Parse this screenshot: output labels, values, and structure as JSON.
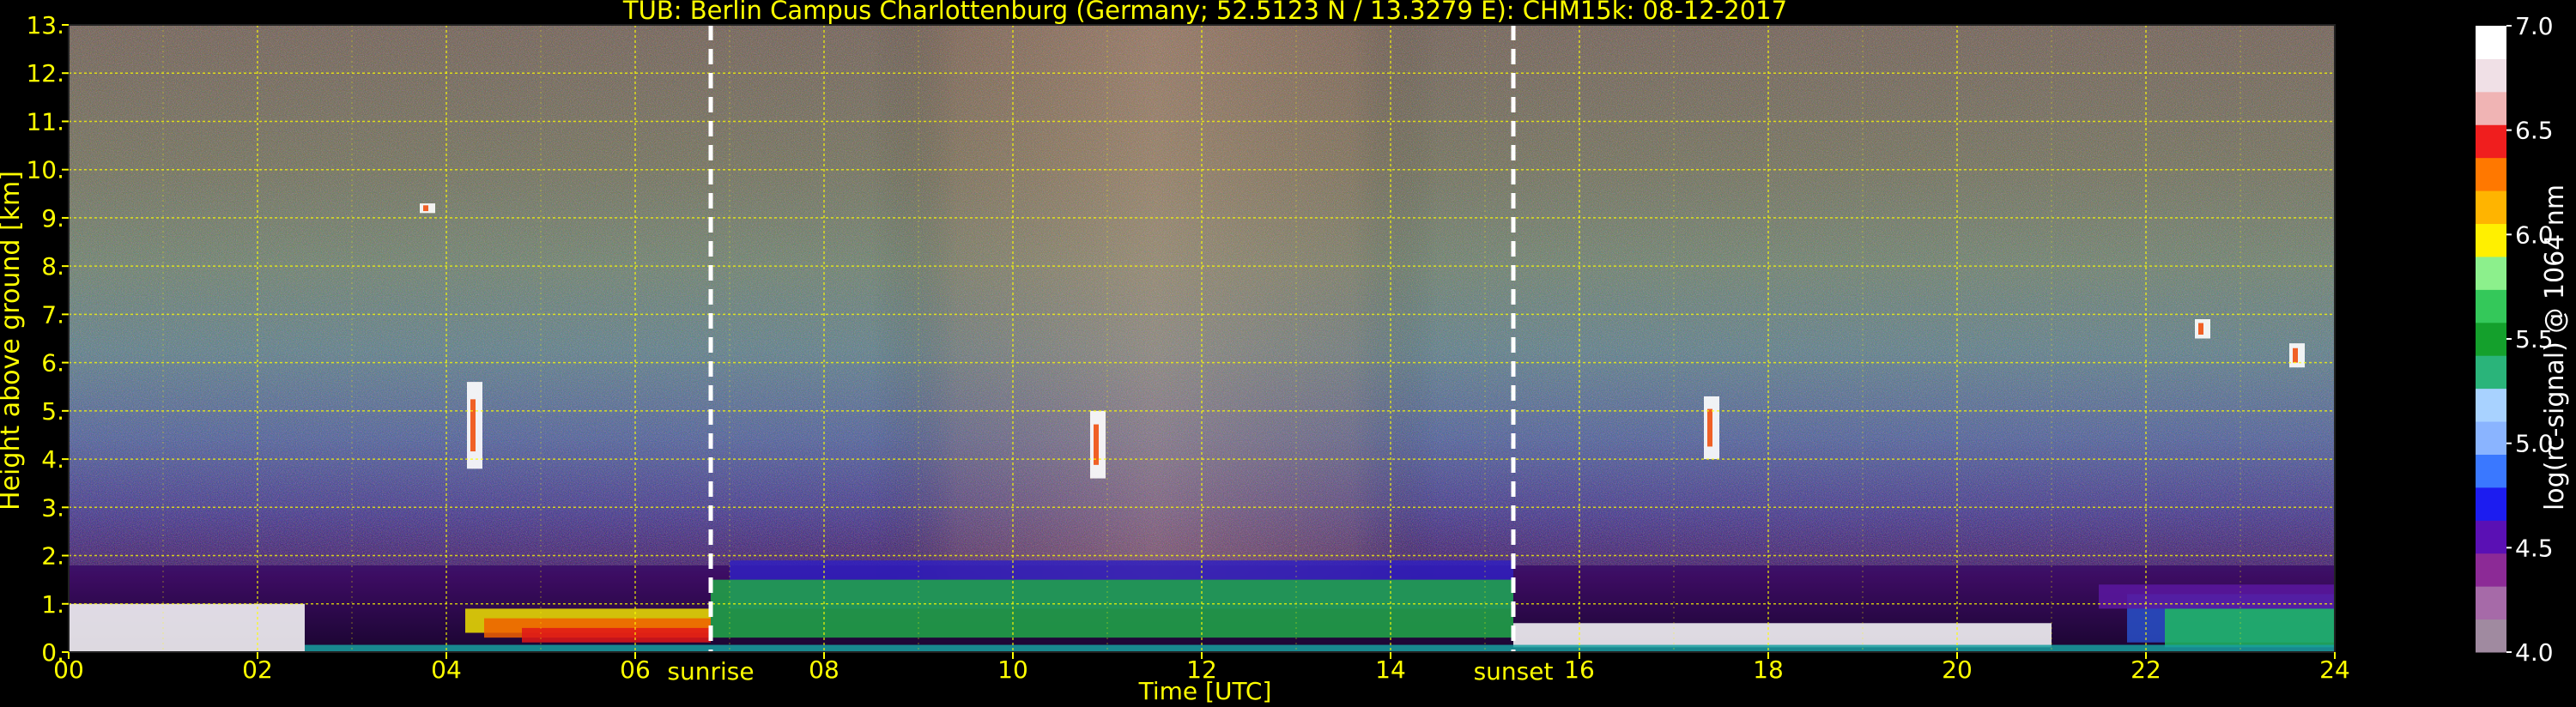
{
  "chart_data": {
    "type": "heatmap",
    "title": "TUB: Berlin Campus Charlottenburg (Germany; 52.5123 N / 13.3279 E):    CHM15k: 08-12-2017",
    "xlabel": "Time [UTC]",
    "ylabel": "Height above ground [km]",
    "xlim": [
      0,
      24
    ],
    "ylim": [
      0,
      13
    ],
    "x_ticks": [
      0,
      2,
      4,
      6,
      8,
      10,
      12,
      14,
      16,
      18,
      20,
      22,
      24
    ],
    "x_tick_labels": [
      "00",
      "02",
      "04",
      "06",
      "08",
      "10",
      "12",
      "14",
      "16",
      "18",
      "20",
      "22",
      "24"
    ],
    "y_ticks": [
      0,
      1,
      2,
      3,
      4,
      5,
      6,
      7,
      8,
      9,
      10,
      11,
      12,
      13
    ],
    "y_tick_labels": [
      "0.",
      "1.",
      "2.",
      "3.",
      "4.",
      "5.",
      "6.",
      "7.",
      "8.",
      "9.",
      "10.",
      "11.",
      "12.",
      "13."
    ],
    "grid": true,
    "grid_color": "#ffff00",
    "annotations": [
      {
        "label": "sunrise",
        "x": 6.8
      },
      {
        "label": "sunset",
        "x": 15.3
      }
    ],
    "colorbar": {
      "label": "log(rc-signal) @ 1064 nm",
      "range": [
        4.0,
        7.0
      ],
      "ticks": [
        4.0,
        4.5,
        5.0,
        5.5,
        6.0,
        6.5,
        7.0
      ],
      "tick_labels": [
        "4.0",
        "4.5",
        "5.0",
        "5.5",
        "6.0",
        "6.5",
        "7.0"
      ],
      "colors": [
        "#a08aa0",
        "#a66aa8",
        "#8c2a96",
        "#5a10b4",
        "#1c1cf0",
        "#3a78ff",
        "#8ab4ff",
        "#a8d2ff",
        "#2ab47a",
        "#14a02c",
        "#34c85a",
        "#8cf08c",
        "#fff000",
        "#ffb400",
        "#ff7800",
        "#f01e1e",
        "#f0b4b4",
        "#f0e0e6",
        "#ffffff"
      ]
    },
    "features": [
      {
        "name": "boundary layer",
        "x_range": [
          0,
          24
        ],
        "top_km": [
          1.0,
          1.9
        ]
      },
      {
        "name": "cloud",
        "x": 4.3,
        "height_km": [
          3.8,
          5.6
        ]
      },
      {
        "name": "cloud",
        "x": 10.9,
        "height_km": [
          3.6,
          5.0
        ]
      },
      {
        "name": "cloud",
        "x": 17.4,
        "height_km": [
          4.0,
          5.3
        ]
      },
      {
        "name": "cloud",
        "x": 22.6,
        "height_km": [
          6.5,
          6.9
        ]
      },
      {
        "name": "cloud",
        "x": 23.6,
        "height_km": [
          5.9,
          6.4
        ]
      },
      {
        "name": "cloud",
        "x": 3.8,
        "height_km": [
          9.1,
          9.3
        ]
      }
    ]
  }
}
